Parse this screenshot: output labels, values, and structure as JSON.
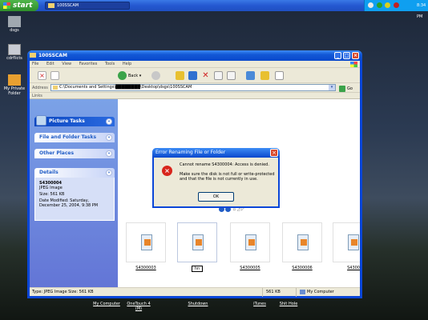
{
  "taskbar": {
    "start_label": "start",
    "task_label": "100SSCAM",
    "clock": "8:34 PM",
    "tray_colors": [
      "#e8e8e8",
      "#28a028",
      "#d8d020",
      "#c02020"
    ]
  },
  "desktop": {
    "icons": [
      {
        "label": "dsgs"
      },
      {
        "label": "cdrflicts"
      },
      {
        "label": "My Private Folder"
      }
    ],
    "quick_links": [
      {
        "label": "My Computer"
      },
      {
        "label": "OneTouch 4 (M)"
      },
      {
        "label": "Shutdown"
      },
      {
        "label": "iTunes"
      },
      {
        "label": "Shit Hole"
      }
    ]
  },
  "explorer": {
    "title": "100SSCAM",
    "menu": [
      "File",
      "Edit",
      "View",
      "Favorites",
      "Tools",
      "Help"
    ],
    "back_label": "Back",
    "address_label": "Address",
    "address_value": "C:\\Documents and Settings\\████████\\Desktop\\dsgs\\100SSCAM",
    "go_label": "Go",
    "links_label": "Links",
    "panels": {
      "picture_tasks": "Picture Tasks",
      "file_folder_tasks": "File and Folder Tasks",
      "other_places": "Other Places",
      "details": "Details"
    },
    "details": {
      "name": "S4300004",
      "type": "JPEG Image",
      "size": "Size: 561 KB",
      "date": "Date Modified: Saturday, December 25, 2004, 9:38 PM"
    },
    "thumbnails": [
      {
        "label": "S4300003"
      },
      {
        "label": "hn"
      },
      {
        "label": "S4300005"
      },
      {
        "label": "S4300006"
      },
      {
        "label": "S4300"
      }
    ],
    "status": {
      "left": "Type: JPEG Image Size: 561 KB",
      "size": "561 KB",
      "location": "My Computer"
    }
  },
  "dialog": {
    "title": "Error Renaming File or Folder",
    "line1": "Cannot rename S4300004: Access is denied.",
    "line2": "Make sure the disk is not full or write-protected and that the file is not currently in use.",
    "ok_label": "OK"
  }
}
